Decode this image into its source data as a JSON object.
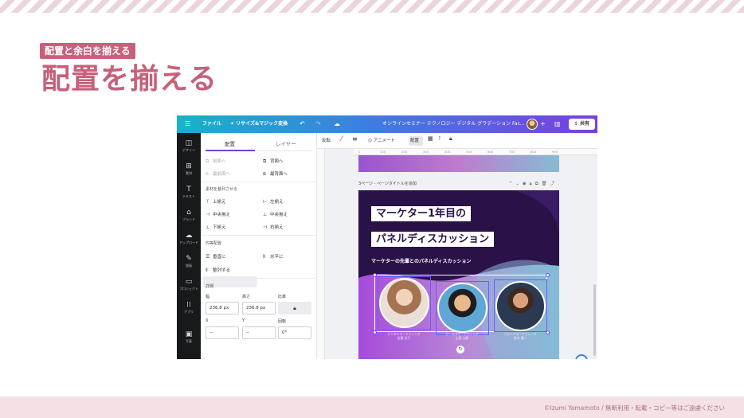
{
  "slide": {
    "tag": "配置と余白を揃える",
    "heading": "配置を揃える",
    "footer": "©Izumi Yamamoto / 無断利用・転載・コピー等はご遠慮ください"
  },
  "colors": {
    "accent_pink": "#c7607a",
    "canva_purple": "#7a3fe0",
    "canva_teal": "#15b4c7"
  },
  "app": {
    "topbar": {
      "menu_icon": "hamburger-icon",
      "file": "ファイル",
      "resize": "リサイズ&マジック変換",
      "doc_title": "オンラインセミナー テクノロジー デジタル グラデーション Fac...",
      "share": "共有"
    },
    "rail": [
      {
        "icon": "layout-icon",
        "glyph": "◫",
        "label": "デザイン"
      },
      {
        "icon": "elements-icon",
        "glyph": "⊞",
        "label": "素材"
      },
      {
        "icon": "text-icon",
        "glyph": "T",
        "label": "テキスト"
      },
      {
        "icon": "brand-icon",
        "glyph": "⌂",
        "label": "ブランド"
      },
      {
        "icon": "upload-icon",
        "glyph": "☁",
        "label": "アップロード"
      },
      {
        "icon": "draw-icon",
        "glyph": "✎",
        "label": "描画"
      },
      {
        "icon": "projects-icon",
        "glyph": "▭",
        "label": "プロジェクト"
      },
      {
        "icon": "apps-icon",
        "glyph": "⁞⁞",
        "label": "アプリ"
      },
      {
        "icon": "photos-icon",
        "glyph": "▣",
        "label": "写真"
      }
    ],
    "panel": {
      "tabs": [
        "配置",
        "レイヤー"
      ],
      "order": [
        "前面へ",
        "背面へ",
        "最前面へ",
        "最背面へ"
      ],
      "align_section": "素材を整列させる",
      "align": [
        "上揃え",
        "左揃え",
        "中央揃え",
        "中央揃え",
        "下揃え",
        "右揃え"
      ],
      "spacing_section": "均等配置",
      "spacing": [
        "垂直に",
        "水平に"
      ],
      "tidy": "整列する",
      "details_section": "詳細",
      "width_label": "幅",
      "height_label": "高さ",
      "ratio_label": "比率",
      "width_value": "236.8 px",
      "height_value": "236.8 px",
      "x_label": "X",
      "y_label": "Y",
      "rotate_label": "回転",
      "x_value": "--",
      "y_value": "--",
      "rotate_value": "0°"
    },
    "toolbar": {
      "flip": "反転",
      "animate": "アニメート",
      "position": "配置"
    },
    "ruler": [
      "0",
      "100",
      "200",
      "300",
      "400",
      "500",
      "600",
      "700",
      "800",
      "900"
    ],
    "page_label": "3ページ - ページタイトルを追加",
    "design": {
      "title_line1": "マーケター1年目の",
      "title_line2": "パネルディスカッション",
      "subtitle": "マーケターの先輩とのパネルディスカッション",
      "speakers": [
        {
          "role": "デジタルマーケティング",
          "name": "佐藤 花子"
        },
        {
          "role": "セールスマーケティング",
          "name": "山田 太郎"
        },
        {
          "role": "ブランドマーケティング",
          "name": "鈴木 健二"
        }
      ]
    }
  }
}
